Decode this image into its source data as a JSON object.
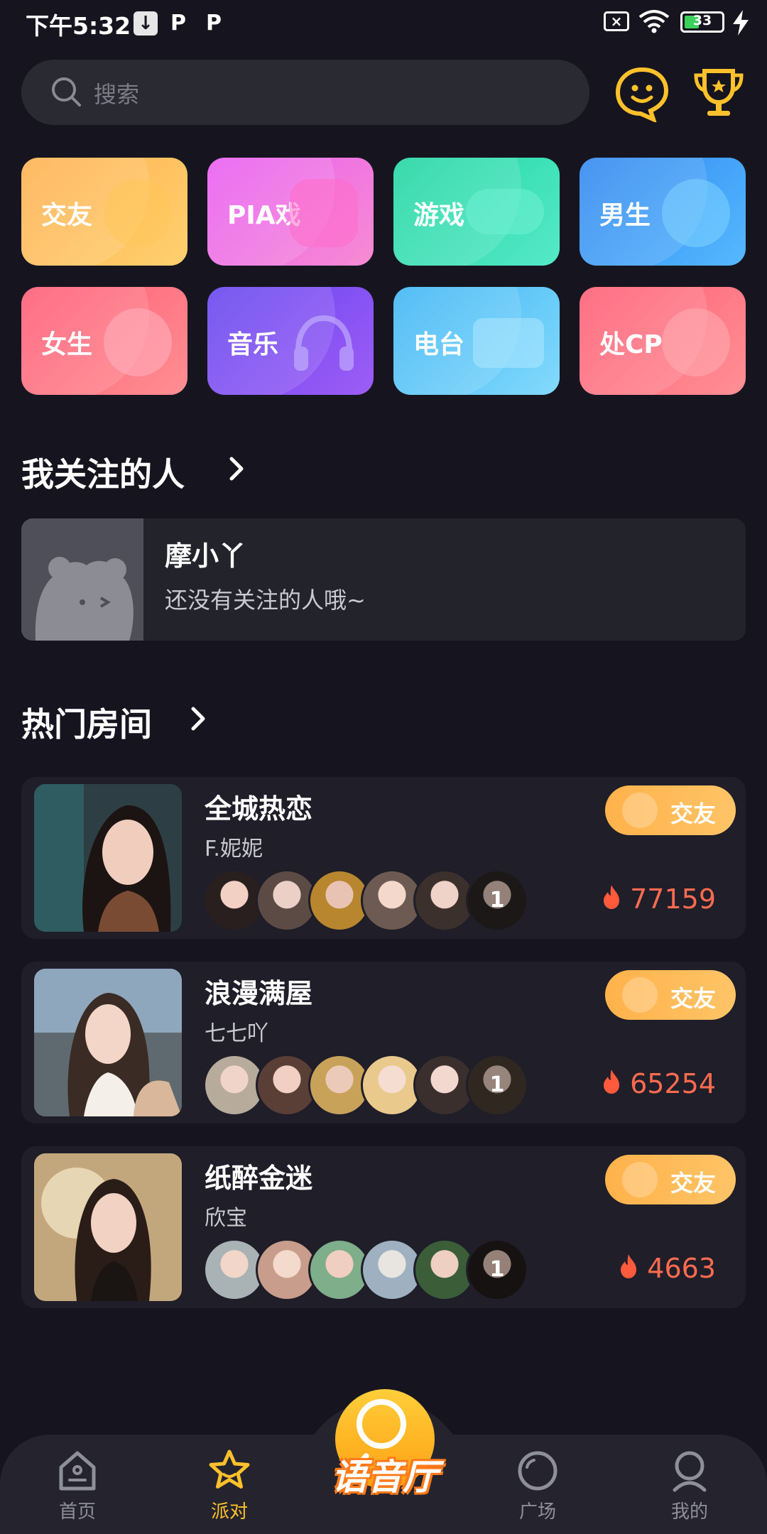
{
  "status_bar": {
    "time": "下午5:32",
    "battery": "33"
  },
  "search": {
    "placeholder": "搜索"
  },
  "categories": [
    {
      "label": "交友",
      "color_a": "#ffb85a",
      "color_b": "#ffcf6d"
    },
    {
      "label": "PIA戏",
      "color_a": "#e35ef0",
      "color_b": "#f58bd6"
    },
    {
      "label": "游戏",
      "color_a": "#24d8a6",
      "color_b": "#4ee6c3"
    },
    {
      "label": "男生",
      "color_a": "#2f8af0",
      "color_b": "#4fb1ff"
    },
    {
      "label": "女生",
      "color_a": "#ff5f78",
      "color_b": "#ff8a8f"
    },
    {
      "label": "音乐",
      "color_a": "#6a47f0",
      "color_b": "#9a5cf5"
    },
    {
      "label": "电台",
      "color_a": "#3fb8f5",
      "color_b": "#7fd7fb"
    },
    {
      "label": "处CP",
      "color_a": "#ff6176",
      "color_b": "#ff8b93"
    }
  ],
  "following": {
    "title": "我关注的人",
    "name": "摩小丫",
    "empty_text": "还没有关注的人哦~"
  },
  "hot_rooms": {
    "title": "热门房间",
    "rooms": [
      {
        "title": "全城热恋",
        "host": "F.妮妮",
        "tag": "交友",
        "member_count": "1",
        "heat": "77159"
      },
      {
        "title": "浪漫满屋",
        "host": "七七吖",
        "tag": "交友",
        "member_count": "1",
        "heat": "65254"
      },
      {
        "title": "纸醉金迷",
        "host": "欣宝",
        "tag": "交友",
        "member_count": "1",
        "heat": "4663"
      }
    ]
  },
  "bottom_nav": {
    "home": "首页",
    "party": "派对",
    "center": "语音厅",
    "square": "广场",
    "mine": "我的"
  },
  "colors": {
    "background": "#16151f",
    "accent": "#ffc12b",
    "heat": "#ff6b4f"
  }
}
